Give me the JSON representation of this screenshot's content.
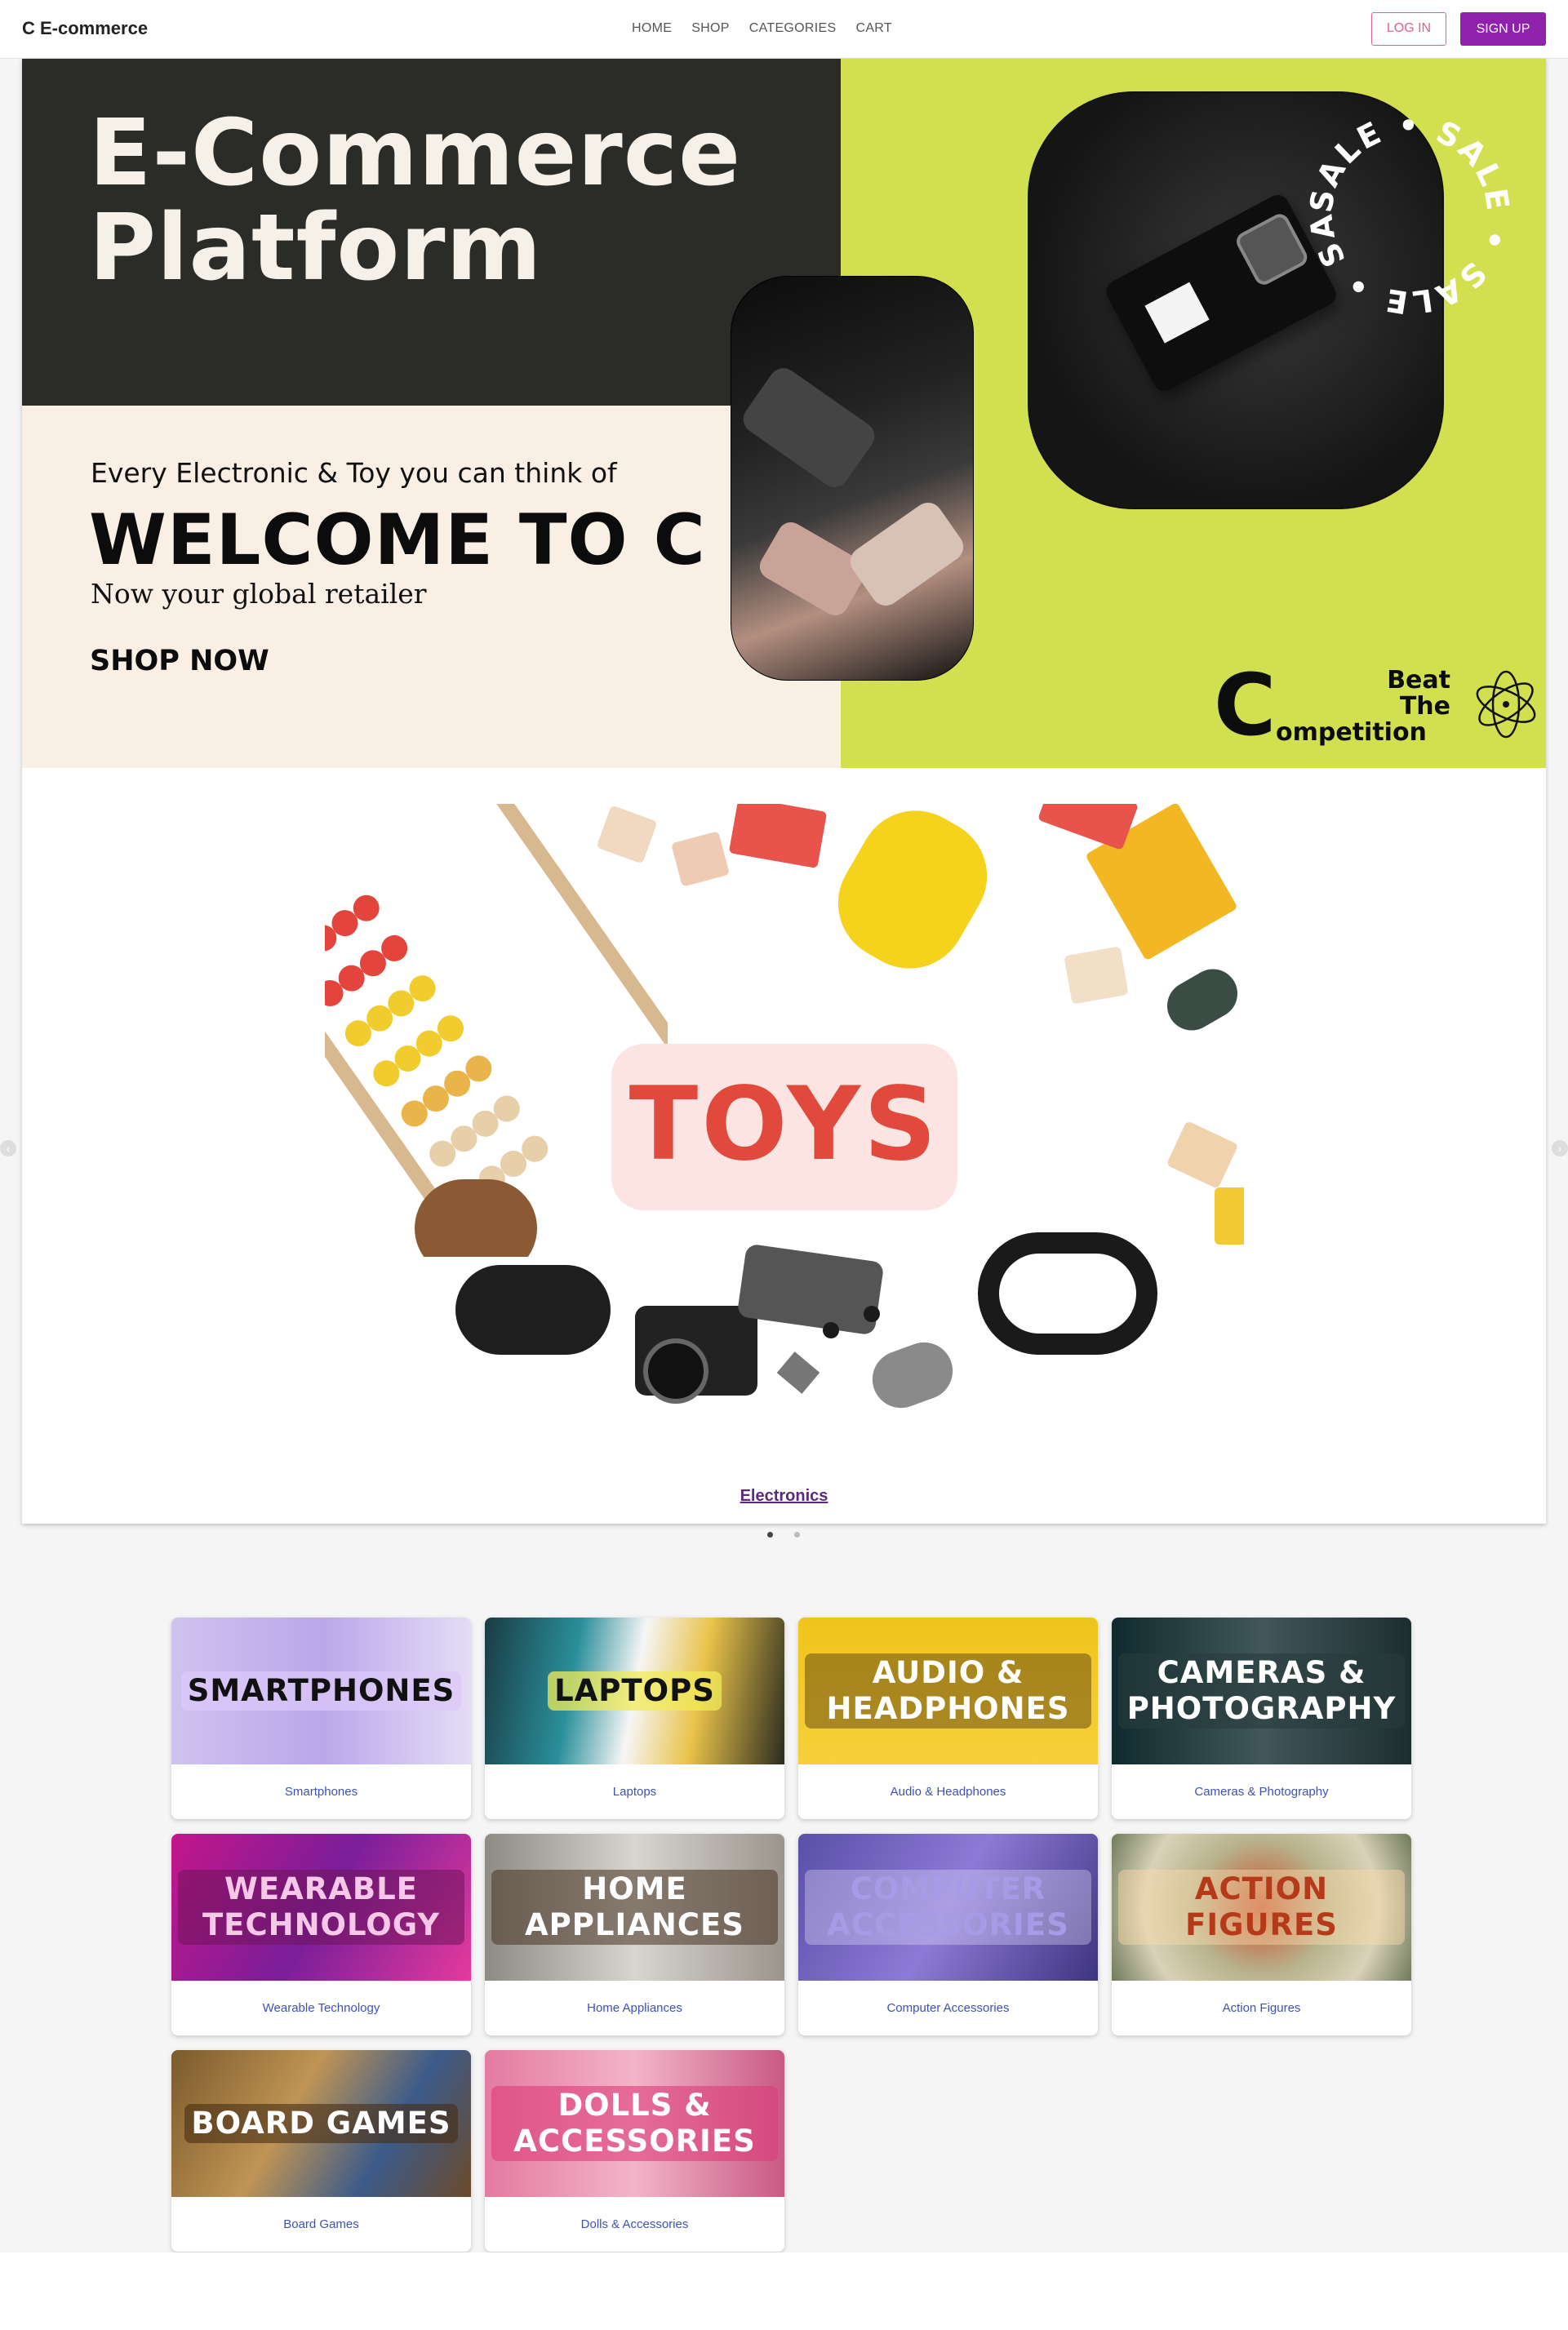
{
  "nav": {
    "brand": "C E-commerce",
    "links": [
      "HOME",
      "SHOP",
      "CATEGORIES",
      "CART"
    ],
    "login": "LOG IN",
    "signup": "SIGN UP"
  },
  "banner": {
    "title_line1": "E-Commerce",
    "title_line2": "Platform",
    "tagline": "Every Electronic & Toy you can think of",
    "welcome": "WELCOME TO C",
    "retailer": "Now your global retailer",
    "shop_now": "SHOP NOW",
    "sale_word": "SALE",
    "beat_c": "C",
    "beat_line1": "Beat",
    "beat_line2": "The",
    "beat_line3": "ompetition"
  },
  "carousel": {
    "slide_label": "TOYS",
    "caption": "Electronics",
    "prev_icon": "chevron-left-icon",
    "next_icon": "chevron-right-icon",
    "slide_count": 2,
    "active_slide": 1
  },
  "categories": [
    {
      "title": "SMARTPHONES",
      "caption": "Smartphones"
    },
    {
      "title": "LAPTOPS",
      "caption": "Laptops"
    },
    {
      "title": "AUDIO & HEADPHONES",
      "caption": "Audio & Headphones"
    },
    {
      "title": "CAMERAS & PHOTOGRAPHY",
      "caption": "Cameras & Photography"
    },
    {
      "title": "WEARABLE TECHNOLOGY",
      "caption": "Wearable Technology"
    },
    {
      "title": "HOME APPLIANCES",
      "caption": "Home Appliances"
    },
    {
      "title": "COMPUTER ACCESSORIES",
      "caption": "Computer Accessories"
    },
    {
      "title": "ACTION FIGURES",
      "caption": "Action Figures"
    },
    {
      "title": "BOARD GAMES",
      "caption": "Board Games"
    },
    {
      "title": "DOLLS & ACCESSORIES",
      "caption": "Dolls & Accessories"
    }
  ],
  "colors": {
    "accent_purple": "#8e22ad",
    "login_pink": "#e0608e",
    "banner_lime": "#d2e04f",
    "banner_dark": "#2b2b28",
    "banner_cream": "#f9efe5",
    "toys_red": "#e0493c",
    "caption_blue": "#3f51b5"
  }
}
